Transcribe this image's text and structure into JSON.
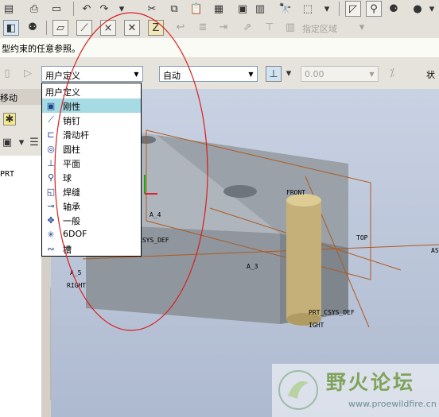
{
  "status_prompt": "型约束的任意参照。",
  "dashboard": {
    "constraint_type": "用户定义",
    "auto_mode": "自动",
    "offset_value": "0.00",
    "status_label": "状"
  },
  "tabs": {
    "move_tab": "移动"
  },
  "toolbar": {
    "specified_region": "指定区域"
  },
  "left_panel": {
    "model_tree_item": "PRT"
  },
  "dropdown": {
    "header": "用户定义",
    "items": [
      {
        "label": "刚性",
        "icon": "rigid-icon",
        "highlighted": true
      },
      {
        "label": "销钉",
        "icon": "pin-icon"
      },
      {
        "label": "滑动杆",
        "icon": "slider-icon"
      },
      {
        "label": "圆柱",
        "icon": "cylinder-icon"
      },
      {
        "label": "平面",
        "icon": "planar-icon"
      },
      {
        "label": "球",
        "icon": "ball-icon"
      },
      {
        "label": "焊缝",
        "icon": "weld-icon"
      },
      {
        "label": "轴承",
        "icon": "bearing-icon"
      },
      {
        "label": "一般",
        "icon": "general-icon"
      },
      {
        "label": "6DOF",
        "icon": "6dof-icon"
      },
      {
        "label": "槽",
        "icon": "slot-icon"
      }
    ]
  },
  "model_labels": {
    "front": "FRONT",
    "top": "TOP",
    "a4": "A_4",
    "a5": "A_5",
    "a3": "A_3",
    "asm": "AS",
    "csys_def": "CSYS_DEF",
    "asm_csys_def": "PRT_CSYS_DEF",
    "right": "RIGHT",
    "right2": "IGHT"
  },
  "watermark": {
    "title": "野火论坛",
    "url": "www.proewildfire.cn"
  },
  "colors": {
    "highlight": "#a6dbe4",
    "annotation_circle": "#d92020",
    "datum": "#b05a1e",
    "block": "#a6adb4"
  }
}
